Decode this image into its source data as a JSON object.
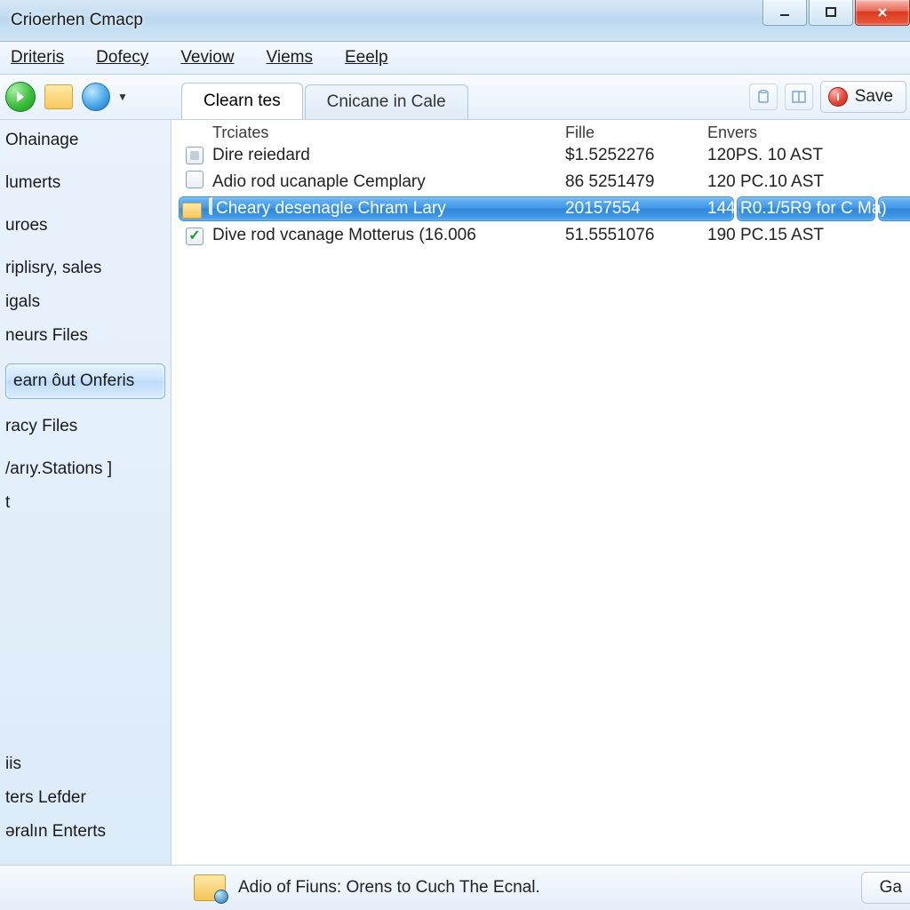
{
  "window": {
    "title": "Crioerhen Cmacp"
  },
  "menu": {
    "items": [
      "Driteris",
      "Dofecy",
      "Veviow",
      "Viems",
      "Eeelp"
    ]
  },
  "tabs": {
    "items": [
      {
        "label": "Clearn tes",
        "active": true
      },
      {
        "label": "Cnicane in Cale",
        "active": false
      }
    ]
  },
  "toolbar": {
    "save_label": "Save"
  },
  "sidebar": {
    "items": [
      "Ohainage",
      "lumerts",
      "uroes",
      "riplisry, sales",
      "igals",
      "neurs Files",
      "earn ôut Onferis",
      "racy Files",
      "/arıy.Stations    ]",
      "t"
    ],
    "selected_index": 6,
    "bottom_items": [
      "iis",
      "ters Lefder",
      "əralın Enterts"
    ]
  },
  "table": {
    "headers": {
      "name": "Trciates",
      "fille": "Fille",
      "envers": "Envers"
    },
    "rows": [
      {
        "check": "grey",
        "name": "Dire reiedard",
        "fille": "$1.5252276",
        "env": "120PS. 10 AST",
        "selected": false
      },
      {
        "check": "empty",
        "name": "Adio rod ucanaple Cemplary",
        "fille": "86 5251479",
        "env": "120 PC.10 AST",
        "selected": false
      },
      {
        "check": "empty",
        "name": "Cheary desenagle Chram Lary",
        "fille": "20157554",
        "env": "144 R0.1/5R9 for C Ma)",
        "selected": true,
        "folder": true
      },
      {
        "check": "checked",
        "name": "Dive rod vcanage Motterus (16.006",
        "fille": "51.5551076",
        "env": "190 PC.15 AST",
        "selected": false
      }
    ]
  },
  "status": {
    "text": "Adio of Fiuns: Orens to Cuch The Ecnal.",
    "button": "Ga"
  }
}
